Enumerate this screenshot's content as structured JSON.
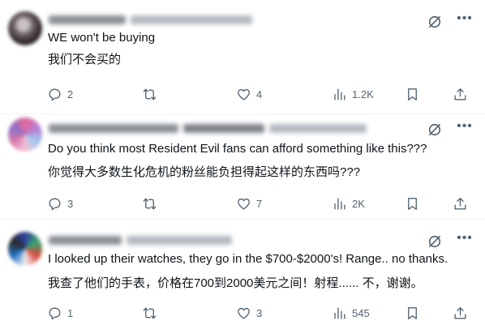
{
  "tweets": [
    {
      "text_en": "WE won't be buying",
      "text_zh": "我们不会买的",
      "replies": "2",
      "likes": "4",
      "views": "1.2K",
      "avatar_colors": [
        "#6d6268",
        "#c9c2c4"
      ]
    },
    {
      "text_en": "Do you think most Resident Evil fans can afford something like this???",
      "text_zh": "你觉得大多数生化危机的粉丝能负担得起这样的东西吗???",
      "replies": "3",
      "likes": "7",
      "views": "2K",
      "avatar_colors": [
        "#e46a9a",
        "#9ec9f0"
      ]
    },
    {
      "text_en": "I looked up their watches, they go in the $700-$2000's! Range..  no thanks.",
      "text_zh": "我查了他们的手表，价格在700到2000美元之间！射程...... 不，谢谢。",
      "replies": "1",
      "likes": "3",
      "views": "545",
      "avatar_colors": [
        "#2e3f9e",
        "#d9473f"
      ]
    }
  ],
  "icons": {
    "reply": "reply-icon",
    "retweet": "retweet-icon",
    "like": "heart-icon",
    "views": "views-icon",
    "bookmark": "bookmark-icon",
    "share": "share-icon",
    "grok": "grok-icon",
    "more": "more-icon"
  },
  "colors": {
    "text": "#0f1419",
    "secondary": "#536471",
    "divider": "#eff3f4"
  }
}
